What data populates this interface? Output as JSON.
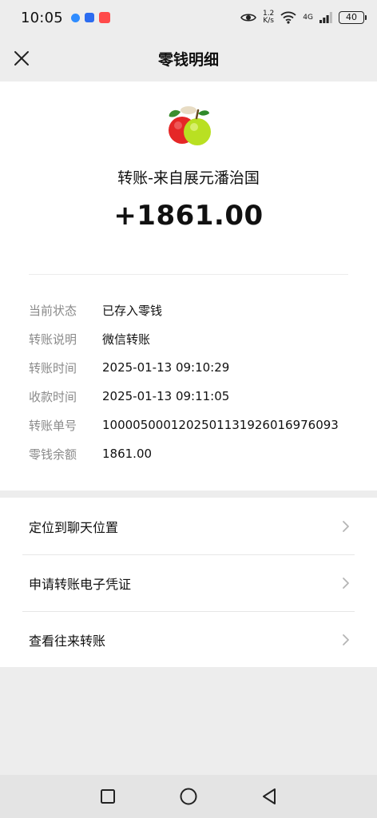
{
  "status_bar": {
    "time": "10:05",
    "net_speed_top": "1.2",
    "net_speed_bottom": "K/s",
    "network_type": "4G",
    "battery": "40"
  },
  "nav": {
    "title": "零钱明细",
    "close_icon": "close-icon"
  },
  "transaction": {
    "payer": "转账-来自展元潘治国",
    "amount": "+1861.00",
    "avatar_icon": "apple-logo"
  },
  "details": [
    {
      "label": "当前状态",
      "value": "已存入零钱"
    },
    {
      "label": "转账说明",
      "value": "微信转账"
    },
    {
      "label": "转账时间",
      "value": "2025-01-13 09:10:29"
    },
    {
      "label": "收款时间",
      "value": "2025-01-13 09:11:05"
    },
    {
      "label": "转账单号",
      "value": "1000050001202501131926016976093"
    },
    {
      "label": "零钱余额",
      "value": "1861.00"
    }
  ],
  "actions": [
    {
      "label": "定位到聊天位置"
    },
    {
      "label": "申请转账电子凭证"
    },
    {
      "label": "查看往来转账"
    }
  ],
  "colors": {
    "background": "#ededed",
    "card": "#ffffff",
    "label_gray": "#8a8a8a"
  }
}
